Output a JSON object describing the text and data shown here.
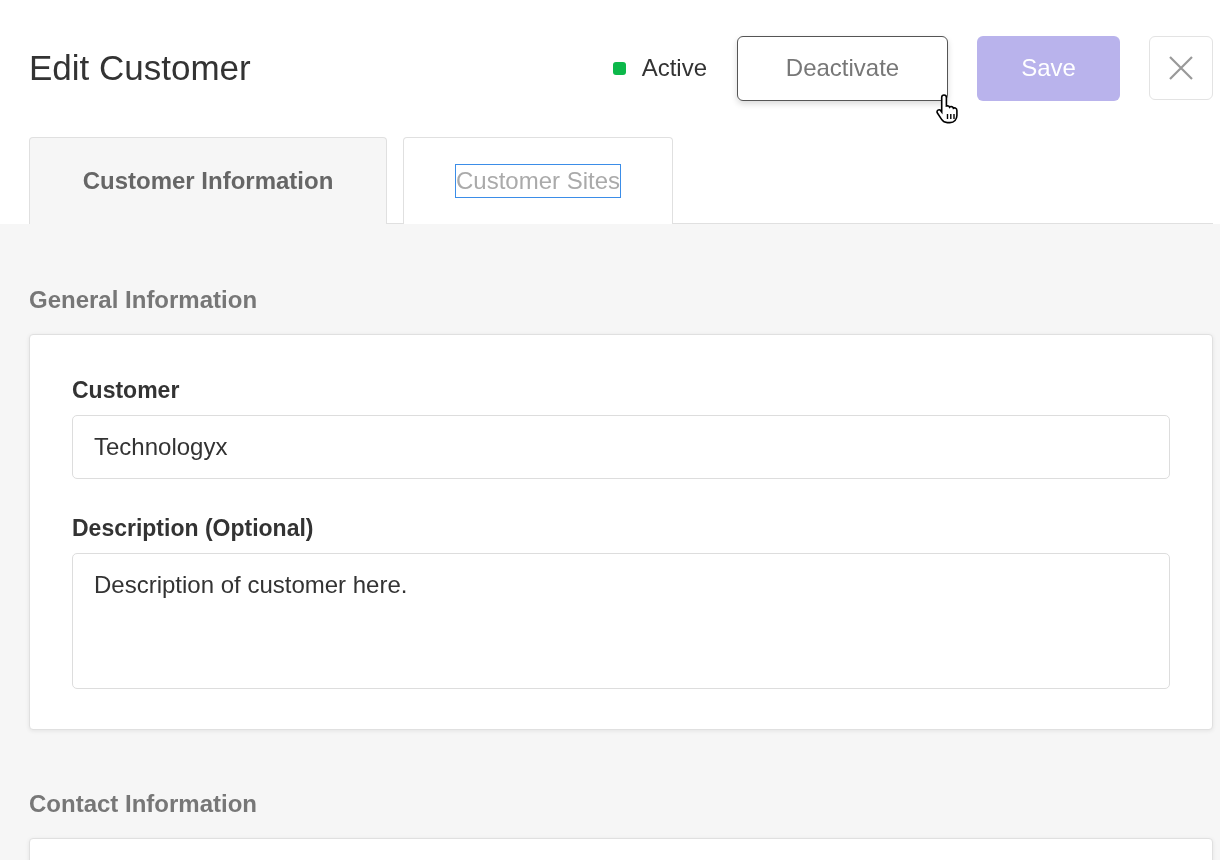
{
  "title": "Edit Customer",
  "status": {
    "label": "Active",
    "active": true
  },
  "buttons": [
    {
      "kind": "outline",
      "label": "Deactivate",
      "disabled": false,
      "hovered": true
    },
    {
      "kind": "primary",
      "label": "Save",
      "disabled": true,
      "hovered": false
    }
  ],
  "tabs": [
    {
      "label": "Customer Information",
      "selected": true,
      "focused": false
    },
    {
      "label": "Customer Sites",
      "selected": false,
      "focused": true
    }
  ],
  "sections": [
    {
      "title": "General Information",
      "fields": [
        {
          "label": "Customer",
          "value": "Technologyx",
          "kind": "input"
        },
        {
          "label": "Description (Optional)",
          "value": "Description of customer here.",
          "kind": "textarea"
        }
      ]
    },
    {
      "title": "Contact Information"
    }
  ]
}
